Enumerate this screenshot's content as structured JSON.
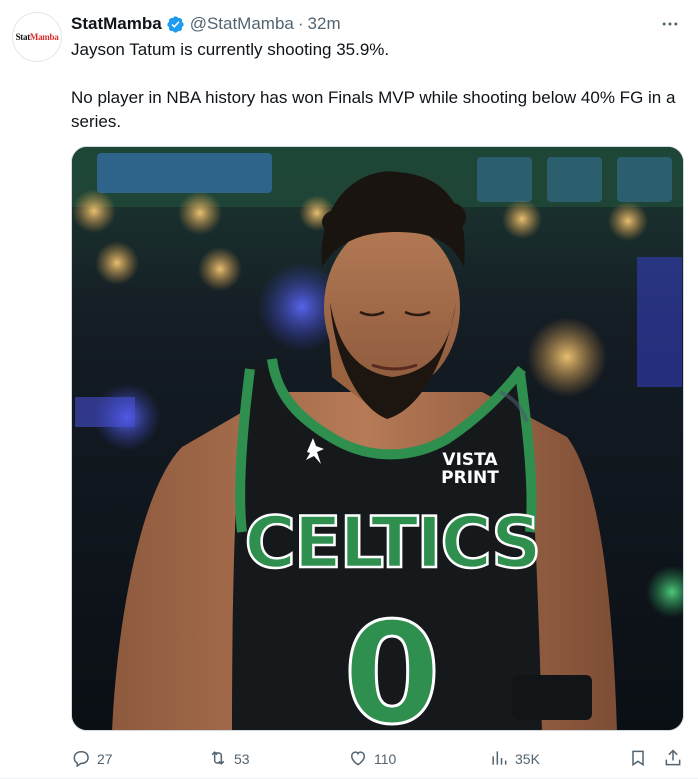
{
  "author": {
    "avatar_text_main": "Stat",
    "avatar_text_accent": "Mamba",
    "display_name": "StatMamba",
    "verified": true,
    "handle": "@StatMamba",
    "separator": "·",
    "time": "32m"
  },
  "tweet": {
    "line1": "Jayson Tatum is currently shooting 35.9%.",
    "line2": "No player in NBA history has won Finals MVP while shooting below 40% FG in a series."
  },
  "media": {
    "jersey_team": "CELTICS",
    "jersey_number": "0",
    "sponsor_line1": "VISTA",
    "sponsor_line2": "PRINT"
  },
  "actions": {
    "replies": "27",
    "reposts": "53",
    "likes": "110",
    "views": "35K"
  },
  "icons": {
    "verified": "verified-badge-icon",
    "more": "more-horizontal-icon",
    "reply": "reply-icon",
    "repost": "repost-icon",
    "like": "heart-icon",
    "views": "views-icon",
    "bookmark": "bookmark-icon",
    "share": "share-icon"
  },
  "colors": {
    "verified_blue": "#1d9bf0",
    "celtics_green": "#2f8f4f",
    "jersey_black": "#15191c",
    "text_secondary": "#536471"
  }
}
